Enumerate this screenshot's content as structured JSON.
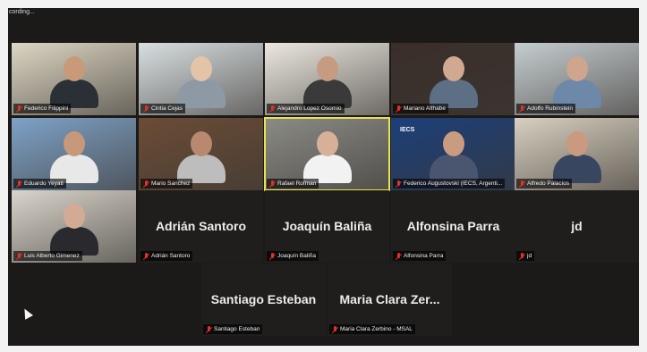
{
  "recording": {
    "label": "cording..."
  },
  "participants": [
    {
      "name": "Federico Filippini",
      "video": true,
      "active": false,
      "head": "#c99a7a",
      "body": "#2b2f36",
      "bg": "#dcd6c3"
    },
    {
      "name": "Cintia Cejas",
      "video": true,
      "active": false,
      "head": "#e3c4a8",
      "body": "#8d9aa6",
      "bg": "#d8dfe1"
    },
    {
      "name": "Alejandro Lopez Osornio",
      "video": true,
      "active": false,
      "head": "#c59c82",
      "body": "#3a3a3a",
      "bg": "#ece8e1"
    },
    {
      "name": "Mariano Althabe",
      "video": true,
      "active": false,
      "head": "#d1a890",
      "body": "#5d6f85",
      "bg": "#3a2e2a"
    },
    {
      "name": "Adolfo Rubinstein",
      "video": true,
      "active": false,
      "head": "#d0a58e",
      "body": "#6d88a8",
      "bg": "#c5cdd0"
    },
    {
      "name": "Eduardo Yeyati",
      "video": true,
      "active": false,
      "head": "#c8987b",
      "body": "#e8e8e8",
      "bg": "#7ea2c7"
    },
    {
      "name": "Mario Sanchez",
      "video": true,
      "active": false,
      "head": "#b8896e",
      "body": "#bdbdbd",
      "bg": "#6b4c36"
    },
    {
      "name": "Rafael Rofman",
      "video": true,
      "active": true,
      "head": "#d8b09a",
      "body": "#f2f2f2",
      "bg": "#8b8b86"
    },
    {
      "name": "Federico Augustovski (IECS, Argenti...",
      "video": true,
      "active": false,
      "head": "#c99c82",
      "body": "#4a5570",
      "bg": "#1c3f7a",
      "logo": "IECS"
    },
    {
      "name": "Alfredo Palacios",
      "video": true,
      "active": false,
      "head": "#c99a80",
      "body": "#39465f",
      "bg": "#d8cfbf"
    },
    {
      "name": "Luis Alberto Gimenez",
      "video": true,
      "active": false,
      "head": "#d3ab94",
      "body": "#2a2a2e",
      "bg": "#d9d5cc"
    },
    {
      "name": "Adrián Santoro",
      "display": "Adrián Santoro",
      "video": false,
      "active": false
    },
    {
      "name": "Joaquín Baliña",
      "display": "Joaquín Baliña",
      "video": false,
      "active": false
    },
    {
      "name": "Alfonsina Parra",
      "display": "Alfonsina Parra",
      "video": false,
      "active": false
    },
    {
      "name": "jd",
      "display": "jd",
      "video": false,
      "active": false
    },
    {
      "name": "Santiago Esteban",
      "display": "Santiago Esteban",
      "video": false,
      "active": false
    },
    {
      "name": "Maria Clara Zerbino - MSAL",
      "display": "Maria Clara Zer...",
      "video": false,
      "active": false
    }
  ],
  "colors": {
    "mute": "#e2312b",
    "active_border": "#e9e34a",
    "background": "#1c1a19"
  }
}
